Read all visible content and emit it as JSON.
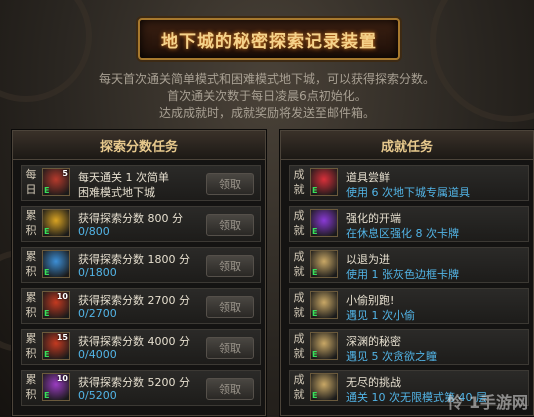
{
  "title": "地下城的秘密探索记录装置",
  "intro": [
    "每天首次通关简单模式和困难模式地下城，可以获得探索分数。",
    "首次通关次数于每日凌晨6点初始化。",
    "达成成就时，成就奖励将发送至邮件箱。"
  ],
  "left_panel": {
    "title": "探索分数任务",
    "items": [
      {
        "tag": "每日",
        "line1": "每天通关 1 次简单",
        "line2": "困难模式地下城",
        "button": "领取",
        "icon": "sword-scroll-icon",
        "icon_num": "5",
        "icon_color": "#b63a2c",
        "blue": false
      },
      {
        "tag": "累积",
        "line1": "获得探索分数 800 分",
        "line2": "0/800",
        "button": "领取",
        "icon": "gold-chest-icon",
        "icon_num": "",
        "icon_color": "#d9a322",
        "blue": true
      },
      {
        "tag": "累积",
        "line1": "获得探索分数 1800 分",
        "line2": "0/1800",
        "button": "领取",
        "icon": "blue-gift-icon",
        "icon_num": "",
        "icon_color": "#3d8fd6",
        "blue": true
      },
      {
        "tag": "累积",
        "line1": "获得探索分数 2700 分",
        "line2": "0/2700",
        "button": "领取",
        "icon": "red-chest-icon",
        "icon_num": "10",
        "icon_color": "#c43a21",
        "blue": true
      },
      {
        "tag": "累积",
        "line1": "获得探索分数 4000 分",
        "line2": "0/4000",
        "button": "领取",
        "icon": "red-chest-icon",
        "icon_num": "15",
        "icon_color": "#c43a21",
        "blue": true
      },
      {
        "tag": "累积",
        "line1": "获得探索分数 5200 分",
        "line2": "0/5200",
        "button": "领取",
        "icon": "purple-card-icon",
        "icon_num": "10",
        "icon_color": "#9b3cc2",
        "blue": true
      }
    ]
  },
  "right_panel": {
    "title": "成就任务",
    "items": [
      {
        "tag": "成就",
        "line1": "道具尝鲜",
        "line2": "使用 6 次地下城专属道具",
        "icon": "red-gem-icon",
        "icon_color": "#d8303a"
      },
      {
        "tag": "成就",
        "line1": "强化的开端",
        "line2": "在休息区强化 8 次卡牌",
        "icon": "purple-orb-icon",
        "icon_color": "#8a3ad6"
      },
      {
        "tag": "成就",
        "line1": "以退为进",
        "line2": "使用 1 张灰色边框卡牌",
        "icon": "scroll-card-icon",
        "icon_color": "#c9a866"
      },
      {
        "tag": "成就",
        "line1": "小偷别跑!",
        "line2": "遇见 1 次小偷",
        "icon": "scroll-card-icon",
        "icon_color": "#c9a866"
      },
      {
        "tag": "成就",
        "line1": "深渊的秘密",
        "line2": "遇见 5 次贪欲之瞳",
        "icon": "scroll-card-icon",
        "icon_color": "#c9a866"
      },
      {
        "tag": "成就",
        "line1": "无尽的挑战",
        "line2": "通关 10 次无限模式第 40 层",
        "icon": "scroll-card-icon",
        "icon_color": "#c9a866"
      }
    ]
  },
  "watermark": "怜 1手游网"
}
